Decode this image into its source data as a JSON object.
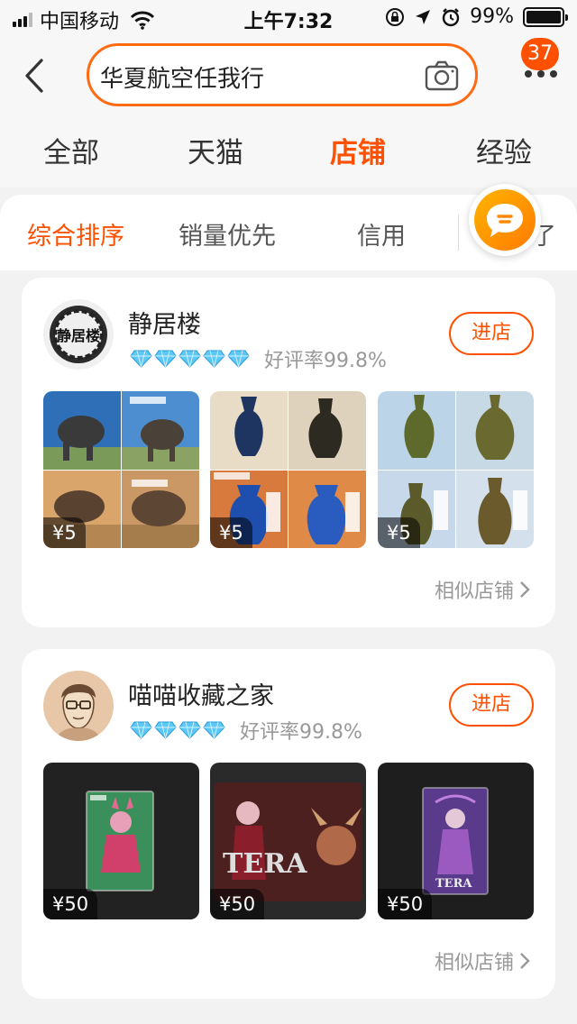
{
  "status_bar": {
    "carrier": "中国移动",
    "time": "上午7:32",
    "battery_text": "99%",
    "battery_level": 0.99
  },
  "header": {
    "search_query": "华夏航空任我行",
    "notification_count": "37",
    "icons": [
      "back-arrow-icon",
      "camera-icon",
      "more-icon"
    ]
  },
  "tabs": [
    "全部",
    "天猫",
    "店铺",
    "经验"
  ],
  "active_tab": "店铺",
  "sort_options": [
    "综合排序",
    "销量优先",
    "信用",
    "筛选"
  ],
  "visible_sort_fragment": "了",
  "shops": [
    {
      "name": "静居楼",
      "diamonds": 5,
      "rating_text": "好评率99.8%",
      "enter_label": "进店",
      "avatar_text": "静居楼",
      "products": [
        {
          "price": "¥5",
          "theme": "elephants"
        },
        {
          "price": "¥5",
          "theme": "blue-vases"
        },
        {
          "price": "¥5",
          "theme": "bronze-vases"
        }
      ],
      "similar_label": "相似店铺"
    },
    {
      "name": "喵喵收藏之家",
      "diamonds": 4,
      "rating_text": "好评率99.8%",
      "enter_label": "进店",
      "products": [
        {
          "price": "¥50",
          "theme": "tera-card-pink"
        },
        {
          "price": "¥50",
          "theme": "tera-card-wide"
        },
        {
          "price": "¥50",
          "theme": "tera-card-purple"
        }
      ],
      "similar_label": "相似店铺"
    }
  ],
  "product_card_logo_text": "TERA",
  "colors": {
    "accent": "#ff5000",
    "chat_button": "#ffa000",
    "diamond": "#5bc8f5"
  }
}
